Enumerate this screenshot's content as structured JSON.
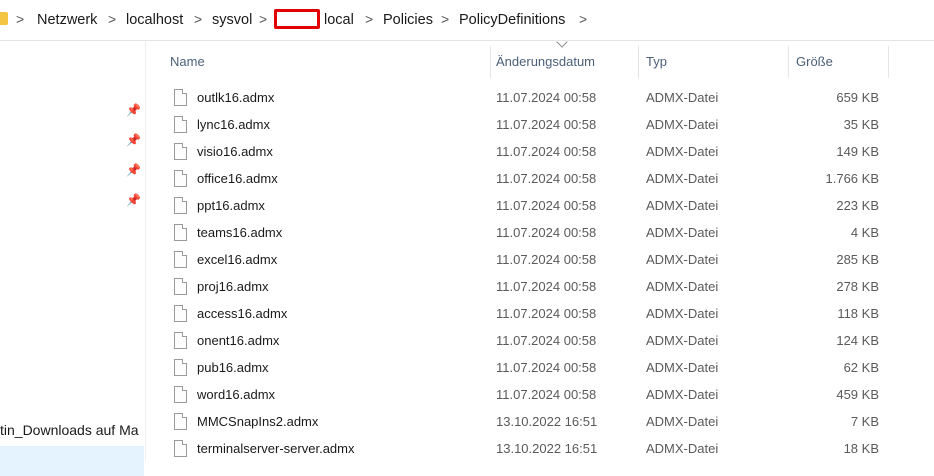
{
  "breadcrumb": {
    "items": [
      "Netzwerk",
      "localhost",
      "sysvol",
      "local",
      "Policies",
      "PolicyDefinitions"
    ],
    "separator": ">"
  },
  "nav": {
    "item_text": "tin_Downloads auf Ma"
  },
  "columns": {
    "name": "Name",
    "date": "Änderungsdatum",
    "type": "Typ",
    "size": "Größe"
  },
  "files": [
    {
      "name": "outlk16.admx",
      "date": "11.07.2024 00:58",
      "type": "ADMX-Datei",
      "size": "659 KB"
    },
    {
      "name": "lync16.admx",
      "date": "11.07.2024 00:58",
      "type": "ADMX-Datei",
      "size": "35 KB"
    },
    {
      "name": "visio16.admx",
      "date": "11.07.2024 00:58",
      "type": "ADMX-Datei",
      "size": "149 KB"
    },
    {
      "name": "office16.admx",
      "date": "11.07.2024 00:58",
      "type": "ADMX-Datei",
      "size": "1.766 KB"
    },
    {
      "name": "ppt16.admx",
      "date": "11.07.2024 00:58",
      "type": "ADMX-Datei",
      "size": "223 KB"
    },
    {
      "name": "teams16.admx",
      "date": "11.07.2024 00:58",
      "type": "ADMX-Datei",
      "size": "4 KB"
    },
    {
      "name": "excel16.admx",
      "date": "11.07.2024 00:58",
      "type": "ADMX-Datei",
      "size": "285 KB"
    },
    {
      "name": "proj16.admx",
      "date": "11.07.2024 00:58",
      "type": "ADMX-Datei",
      "size": "278 KB"
    },
    {
      "name": "access16.admx",
      "date": "11.07.2024 00:58",
      "type": "ADMX-Datei",
      "size": "118 KB"
    },
    {
      "name": "onent16.admx",
      "date": "11.07.2024 00:58",
      "type": "ADMX-Datei",
      "size": "124 KB"
    },
    {
      "name": "pub16.admx",
      "date": "11.07.2024 00:58",
      "type": "ADMX-Datei",
      "size": "62 KB"
    },
    {
      "name": "word16.admx",
      "date": "11.07.2024 00:58",
      "type": "ADMX-Datei",
      "size": "459 KB"
    },
    {
      "name": "MMCSnapIns2.admx",
      "date": "13.10.2022 16:51",
      "type": "ADMX-Datei",
      "size": "7 KB"
    },
    {
      "name": "terminalserver-server.admx",
      "date": "13.10.2022 16:51",
      "type": "ADMX-Datei",
      "size": "18 KB"
    }
  ],
  "colors": {
    "selection": "#e5f3ff",
    "redaction_border": "#e20000",
    "header_text": "#4c607a"
  }
}
